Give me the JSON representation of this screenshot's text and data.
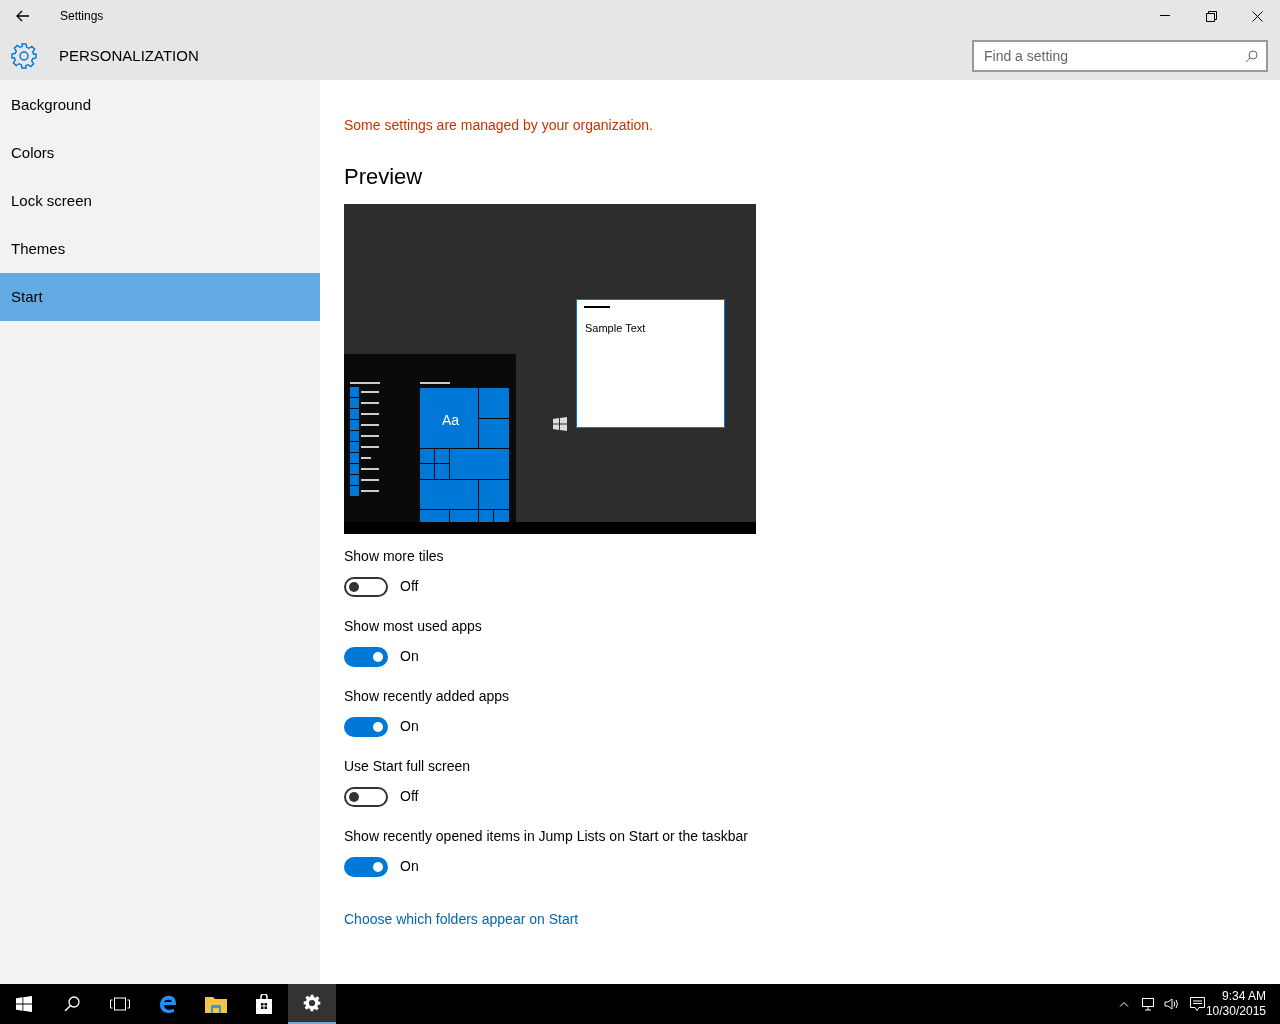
{
  "window": {
    "title": "Settings"
  },
  "header": {
    "title": "PERSONALIZATION",
    "search": {
      "placeholder": "Find a setting"
    }
  },
  "sidebar": {
    "items": [
      {
        "label": "Background",
        "selected": false
      },
      {
        "label": "Colors",
        "selected": false
      },
      {
        "label": "Lock screen",
        "selected": false
      },
      {
        "label": "Themes",
        "selected": false
      },
      {
        "label": "Start",
        "selected": true
      }
    ]
  },
  "notice": "Some settings are managed by your organization.",
  "preview": {
    "heading": "Preview",
    "tile_label": "Aa",
    "sample_text": "Sample Text"
  },
  "toggles": [
    {
      "label": "Show more tiles",
      "on": false,
      "state_text": "Off"
    },
    {
      "label": "Show most used apps",
      "on": true,
      "state_text": "On"
    },
    {
      "label": "Show recently added apps",
      "on": true,
      "state_text": "On"
    },
    {
      "label": "Use Start full screen",
      "on": false,
      "state_text": "Off"
    },
    {
      "label": "Show recently opened items in Jump Lists on Start or the taskbar",
      "on": true,
      "state_text": "On"
    }
  ],
  "link": "Choose which folders appear on Start",
  "taskbar": {
    "time": "9:34 AM",
    "date": "10/30/2015"
  }
}
